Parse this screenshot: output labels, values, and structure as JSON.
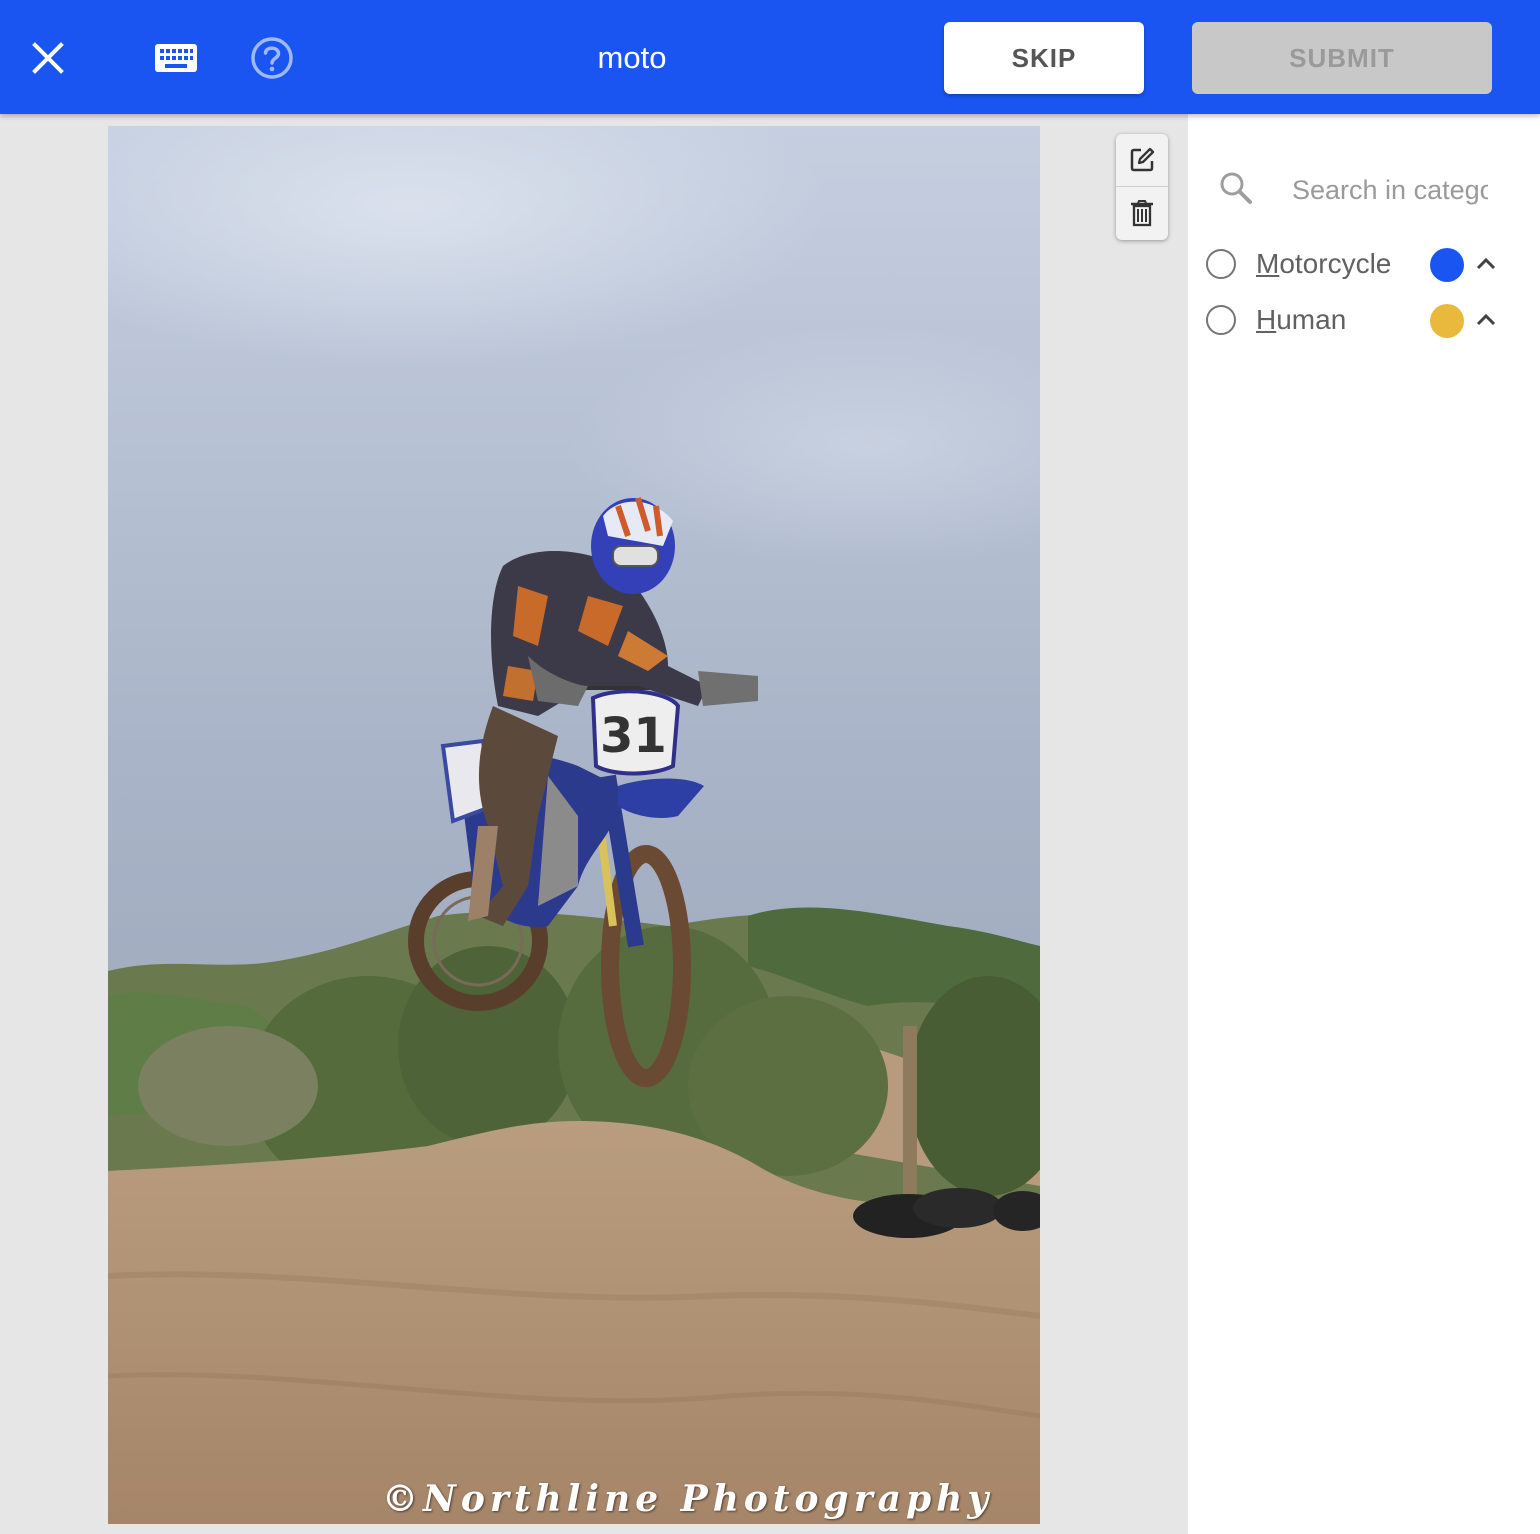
{
  "header": {
    "title": "moto",
    "skip_label": "SKIP",
    "submit_label": "SUBMIT",
    "icons": [
      "close-icon",
      "keyboard-icon",
      "help-icon"
    ]
  },
  "image": {
    "watermark": "©Northline Photography",
    "plate_number": "31"
  },
  "tools": {
    "icons": [
      "edit-icon",
      "trash-icon"
    ]
  },
  "sidebar": {
    "search_placeholder": "Search in categories",
    "categories": [
      {
        "hotkey": "M",
        "rest": "otorcycle",
        "color": "#1a55f2",
        "selected": false
      },
      {
        "hotkey": "H",
        "rest": "uman",
        "color": "#e8b93c",
        "selected": false
      }
    ]
  },
  "colors": {
    "primary": "#1a55f2",
    "submit_disabled": "#c8c8c8"
  }
}
